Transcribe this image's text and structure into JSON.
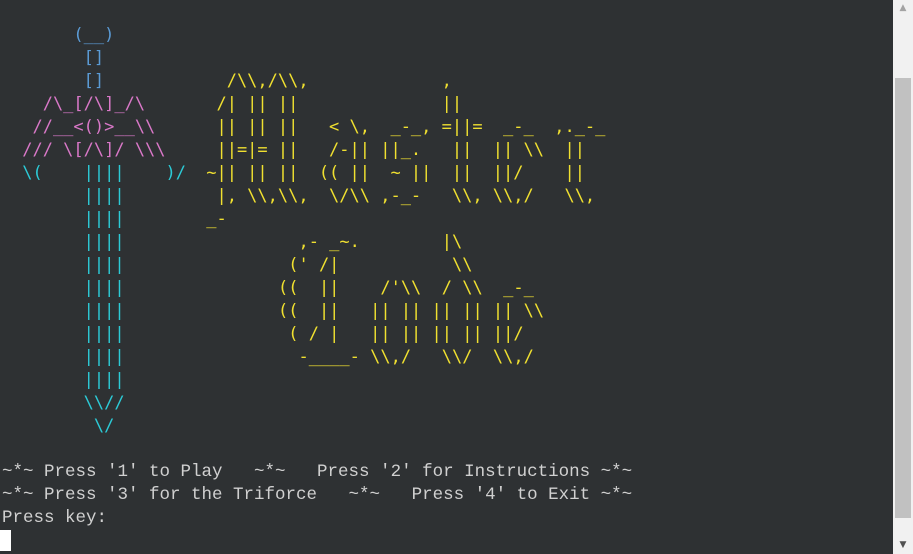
{
  "sword": {
    "lines": [
      "      (__)",
      "       []",
      "       []",
      "   /\\_[/\\]_/\\",
      "  //__<()>__\\\\",
      " /// \\[/\\]/ \\\\\\",
      " \\(    ||||    )/",
      "       ||||",
      "       ||||",
      "       ||||",
      "       ||||",
      "       ||||",
      "       ||||",
      "       ||||",
      "       ||||",
      "       ||||",
      "       \\\\//",
      "        \\/"
    ]
  },
  "title_art": {
    "master_lines": [
      "   /\\\\,/\\\\,             ,",
      "  /| || ||              ||",
      "  || || ||   < \\,  _-_, =||=  _-_  ,._-_",
      "  ||=|= ||   /-|| ||_.   ||  || \\\\  ||",
      " ~|| || ||  (( ||  ~ ||  ||  ||/    ||",
      "  |, \\\\,\\\\,  \\/\\\\ ,-_-   \\\\, \\\\,/   \\\\,",
      " _-"
    ],
    "code_lines": [
      "  ,- _~.        |\\",
      " (' /|           \\\\",
      "((  ||    /'\\\\  / \\\\  _-_",
      "((  ||   || || || || || \\\\",
      " ( / |   || || || || ||/",
      "  -____- \\\\,/   \\\\/  \\\\,/"
    ]
  },
  "menu": {
    "line1": "~*~ Press '1' to Play   ~*~   Press '2' for Instructions ~*~",
    "line2": "~*~ Press '3' for the Triforce   ~*~   Press '4' to Exit ~*~",
    "prompt": "Press key:"
  },
  "colors": {
    "background": "#2e3133",
    "sword_pommel": "#5b9bd5",
    "sword_guard": "#d978c8",
    "sword_blade": "#2ccad6",
    "title": "#f0e030",
    "menu_text": "#d0d0d0"
  },
  "scrollbar": {
    "up_icon": "▲",
    "down_icon": "▼"
  }
}
